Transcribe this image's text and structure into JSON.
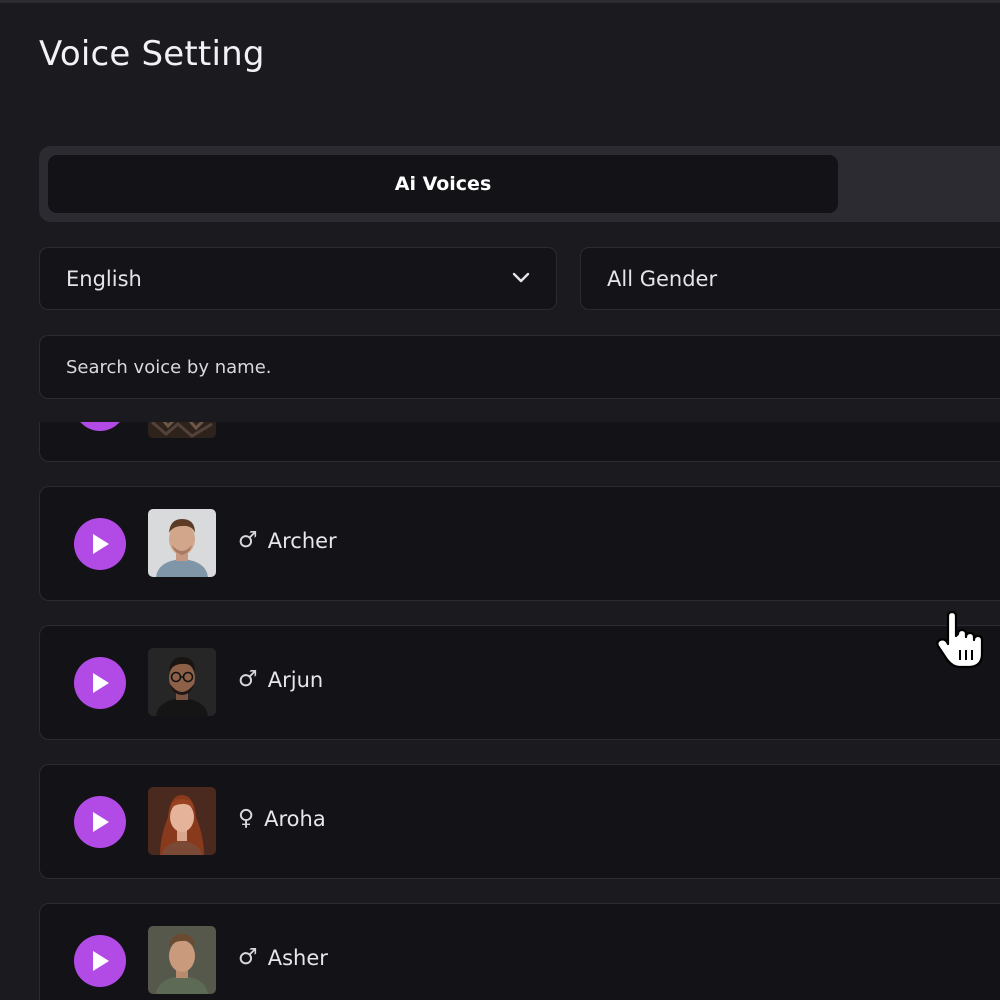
{
  "page": {
    "title": "Voice Setting"
  },
  "tabs": {
    "active_label": "Ai Voices"
  },
  "filters": {
    "language": {
      "selected": "English"
    },
    "gender": {
      "selected": "All Gender"
    }
  },
  "search": {
    "placeholder": "Search voice by name."
  },
  "colors": {
    "accent": "#b24be6",
    "background": "#1b1b1f",
    "card": "#131317",
    "border": "#2b2b31"
  },
  "voices": [
    {
      "name": "",
      "gender_symbol": "",
      "partial": true
    },
    {
      "name": "Archer",
      "gender_symbol": "♂"
    },
    {
      "name": "Arjun",
      "gender_symbol": "♂"
    },
    {
      "name": "Aroha",
      "gender_symbol": "♀"
    },
    {
      "name": "Asher",
      "gender_symbol": "♂"
    }
  ],
  "icons": {
    "play": "play-icon",
    "chevron": "chevron-down-icon",
    "male": "male-icon",
    "female": "female-icon",
    "cursor": "hand-pointer-cursor-icon"
  }
}
